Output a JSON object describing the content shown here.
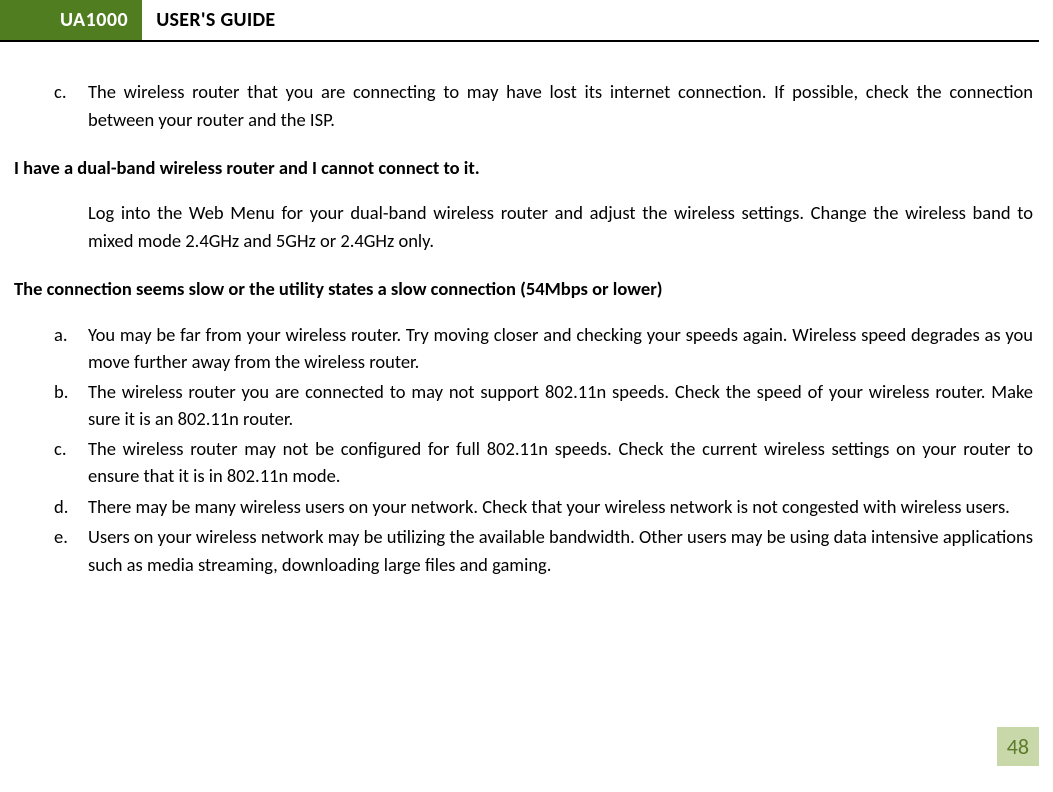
{
  "header": {
    "badge": "UA1000",
    "title": "USER'S GUIDE"
  },
  "itemC": {
    "marker": "c.",
    "text": "The wireless router that you are connecting to may have lost its internet connection. If possible, check the connection between your router and the ISP."
  },
  "heading1": "I have a dual-band wireless router and I cannot connect to it.",
  "para1": "Log into the Web Menu for your dual-band wireless router and adjust the wireless settings. Change the wireless band to mixed mode 2.4GHz and 5GHz or 2.4GHz only.",
  "heading2": "The connection seems slow or the utility states a slow connection (54Mbps or lower)",
  "list2": {
    "a": {
      "marker": "a.",
      "text": "You may be far from your wireless router. Try moving closer and checking your speeds again. Wireless speed degrades as you move further away from the wireless router."
    },
    "b": {
      "marker": "b.",
      "text": "The wireless router you are connected to may not support 802.11n speeds. Check the speed of your wireless router. Make sure it is an 802.11n router."
    },
    "c": {
      "marker": "c.",
      "text": "The wireless router may not be configured for full 802.11n speeds. Check the current wireless settings on your router to ensure that it is in 802.11n mode."
    },
    "d": {
      "marker": "d.",
      "text": "There may be many wireless users on your network. Check that your wireless network is not congested with wireless users."
    },
    "e": {
      "marker": "e.",
      "text": "Users on your wireless network may be utilizing the available bandwidth. Other users may be using data intensive applications such as media streaming, downloading large files and gaming."
    }
  },
  "pageNumber": "48"
}
